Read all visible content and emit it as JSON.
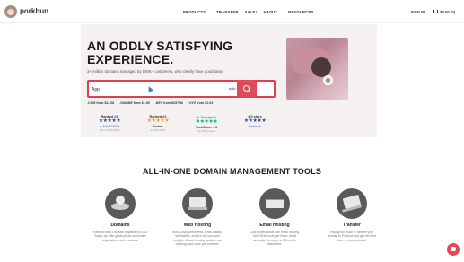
{
  "brand": {
    "name": "porkbun"
  },
  "nav": {
    "links": [
      "PRODUCTS ⌄",
      "TRANSFER",
      "SALE!",
      "ABOUT ⌄",
      "RESOURCES ⌄"
    ],
    "sign_in": "SIGN IN",
    "cart": "$0.00 (0)"
  },
  "hero": {
    "headline": "AN ODDLY SATISFYING EXPERIENCE.",
    "subtext": "3+ million domains managed by 500K+ customers, who clearly have good taste.",
    "search": {
      "value": "App",
      "type_label": "bulk search ⌄"
    },
    "tlds": [
      ".COM from $11.08",
      ".ONLINE from $1.06",
      ".DEV from $257.96",
      ".XYZ from $2.04"
    ],
    "ratings": [
      {
        "title": "Ranked #1",
        "stars": "★★★★★",
        "line2": "★ Mar TODAY",
        "line3": "Since 2018 2022",
        "color": "blue"
      },
      {
        "title": "Ranked #1",
        "stars": "★★★★★",
        "line2": "Forbes",
        "line3": "SINCE 2023",
        "color": "orange"
      },
      {
        "title": "★ Trustpilot",
        "stars": "★★★★★",
        "line2": "TrustScore 4.5",
        "line3": "11,615 reviews",
        "color": "green"
      },
      {
        "title": "4.5 stars",
        "stars": "★★★★★",
        "line2": "facebook",
        "line3": "",
        "color": "blue"
      }
    ]
  },
  "tools": {
    "title": "ALL-IN-ONE DOMAIN MANAGEMENT TOOLS",
    "items": [
      {
        "name": "Domains",
        "desc": "Ranked the #1 domain registrar by USA Today, we offer great prices on domain registrations and renewals."
      },
      {
        "name": "Web Hosting",
        "desc": "With Cloud WordPress, Links-station, WebsiteBo, a link in bio tool, and multiple cPanel hosting options, our hosting plans have you covered."
      },
      {
        "name": "Email Hosting",
        "desc": "Look professional with email hosting. Only $24/month per inbox, billed annually. Compare to $6/month elsewhere."
      },
      {
        "name": "Transfer",
        "desc": "Paying too much? Transfer your domain to Porkbun and get the best price on your renewal."
      }
    ]
  }
}
